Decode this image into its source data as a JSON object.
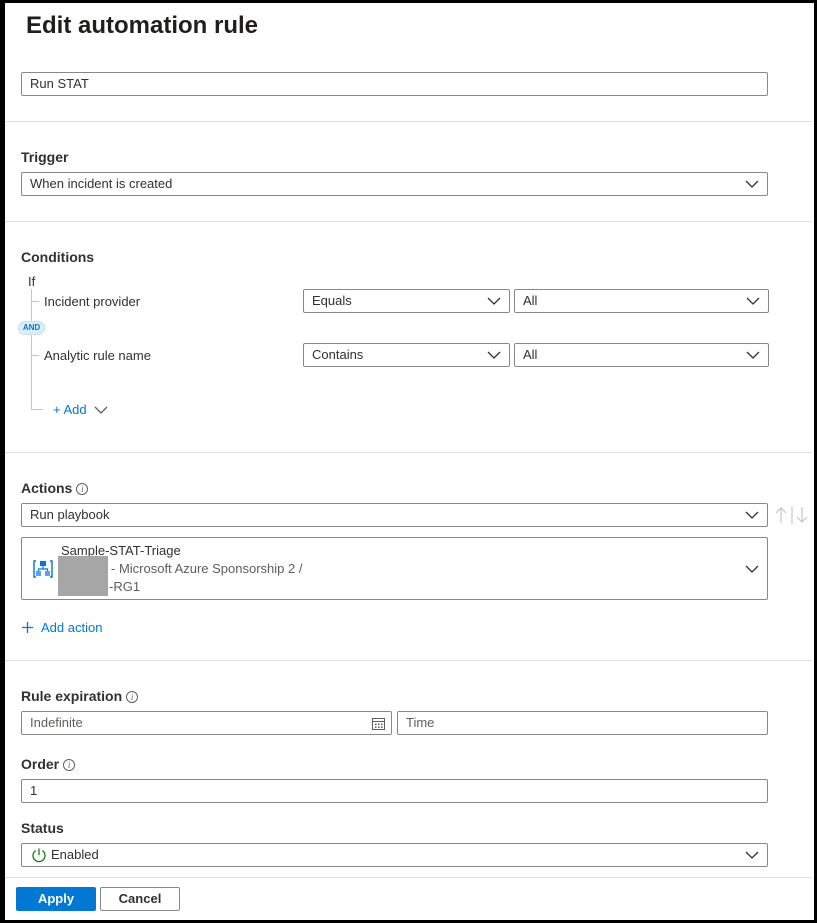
{
  "page": {
    "title": "Edit automation rule"
  },
  "rule_name": {
    "value": "Run STAT"
  },
  "trigger": {
    "label": "Trigger",
    "value": "When incident is created"
  },
  "conditions": {
    "label": "Conditions",
    "if_label": "If",
    "and_label": "AND",
    "rows": [
      {
        "property": "Incident provider",
        "operator": "Equals",
        "value": "All"
      },
      {
        "property": "Analytic rule name",
        "operator": "Contains",
        "value": "All"
      }
    ],
    "add_label": "+ Add"
  },
  "actions": {
    "label": "Actions",
    "action_type": "Run playbook",
    "playbook": {
      "name": "Sample-STAT-Triage",
      "subscription": "- Microsoft Azure Sponsorship 2 /",
      "resource_group": "-RG1"
    },
    "add_action_label": "Add action",
    "reorder_up_icon": "arrow-up-icon",
    "reorder_down_icon": "arrow-down-icon"
  },
  "rule_expiration": {
    "label": "Rule expiration",
    "date_placeholder": "Indefinite",
    "time_placeholder": "Time",
    "calendar_icon": "calendar-icon"
  },
  "order": {
    "label": "Order",
    "value": "1"
  },
  "status": {
    "label": "Status",
    "value": "Enabled",
    "icon": "power-icon"
  },
  "footer": {
    "apply_label": "Apply",
    "cancel_label": "Cancel"
  },
  "colors": {
    "accent": "#0078d4",
    "enabled_green": "#107c10"
  }
}
